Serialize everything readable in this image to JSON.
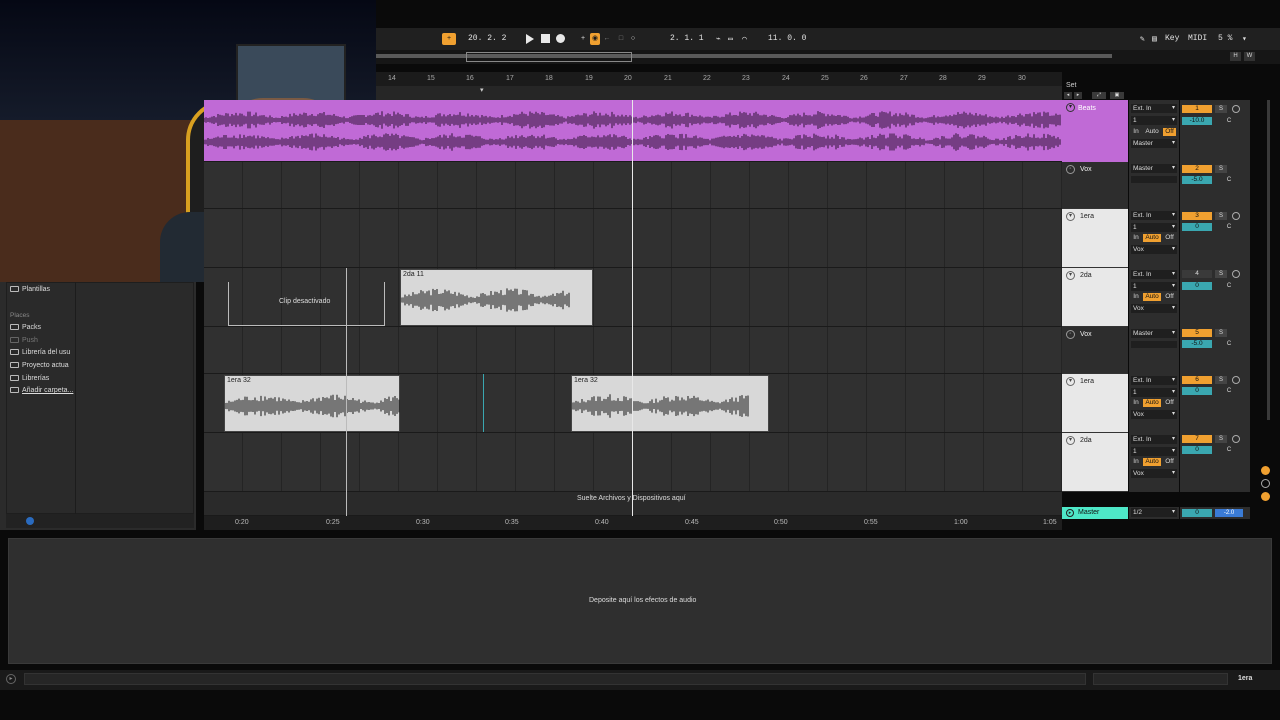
{
  "transport": {
    "tempo_position": "20.  2.  2",
    "loop_start": "2.  1.  1",
    "loop_length": "11.  0.  0",
    "key_label": "Key",
    "midi_label": "MIDI",
    "cpu": "5 %",
    "h_label": "H",
    "w_label": "W"
  },
  "ruler": {
    "bars": [
      "14",
      "15",
      "16",
      "17",
      "18",
      "19",
      "20",
      "21",
      "22",
      "23",
      "24",
      "25",
      "26",
      "27",
      "28",
      "29",
      "30"
    ],
    "set_label": "Set"
  },
  "browser": {
    "templates": "Plantillas",
    "places_header": "Places",
    "places": [
      "Packs",
      "Push",
      "Librería del usu",
      "Proyecto actua",
      "Librerías",
      "Añadir carpeta..."
    ]
  },
  "clips": {
    "disabled_label": "Clip desactivado",
    "clip_2da": "2da 11",
    "clip_1era_a": "1era 32",
    "clip_1era_b": "1era 32",
    "drop_hint": "Suelte Archivos y Dispositivos aquí"
  },
  "tracks": [
    {
      "name": "Beats",
      "input": "Ext. In",
      "channel": "1",
      "monitor_in": "In",
      "monitor_auto": "Auto",
      "monitor_off": "Off",
      "output": "Master",
      "number": "1",
      "solo": "S",
      "volume": "-10.0",
      "pan": "C"
    },
    {
      "name": "Vox",
      "output": "Master",
      "number": "2",
      "solo": "S",
      "volume": "-5.0",
      "pan": "C"
    },
    {
      "name": "1era",
      "input": "Ext. In",
      "channel": "1",
      "monitor_in": "In",
      "monitor_auto": "Auto",
      "monitor_off": "Off",
      "output": "Vox",
      "number": "3",
      "solo": "S",
      "volume": "0",
      "pan": "C"
    },
    {
      "name": "2da",
      "input": "Ext. In",
      "channel": "1",
      "monitor_in": "In",
      "monitor_auto": "Auto",
      "monitor_off": "Off",
      "output": "Vox",
      "number": "4",
      "solo": "S",
      "volume": "0",
      "pan": "C"
    },
    {
      "name": "Vox",
      "output": "Master",
      "number": "5",
      "solo": "S",
      "volume": "-5.0",
      "pan": "C"
    },
    {
      "name": "1era",
      "input": "Ext. In",
      "channel": "1",
      "monitor_in": "In",
      "monitor_auto": "Auto",
      "monitor_off": "Off",
      "output": "Vox",
      "number": "6",
      "solo": "S",
      "volume": "0",
      "pan": "C"
    },
    {
      "name": "2da",
      "input": "Ext. In",
      "channel": "1",
      "monitor_in": "In",
      "monitor_auto": "Auto",
      "monitor_off": "Off",
      "output": "Vox",
      "number": "7",
      "solo": "S",
      "volume": "0",
      "pan": "C"
    }
  ],
  "master": {
    "name": "Master",
    "output": "1/2",
    "volume": "0",
    "pan": "-2.0"
  },
  "time_ruler": [
    "0:20",
    "0:25",
    "0:30",
    "0:35",
    "0:40",
    "0:45",
    "0:50",
    "0:55",
    "1:00",
    "1:05"
  ],
  "fx_hint": "Deposite aquí los efectos de audio",
  "status_track": "1era",
  "colors": {
    "beats_clip": "#c06ad6",
    "accent_orange": "#f0a030",
    "accent_teal": "#3aa7b0",
    "master_green": "#4ee8c8"
  }
}
